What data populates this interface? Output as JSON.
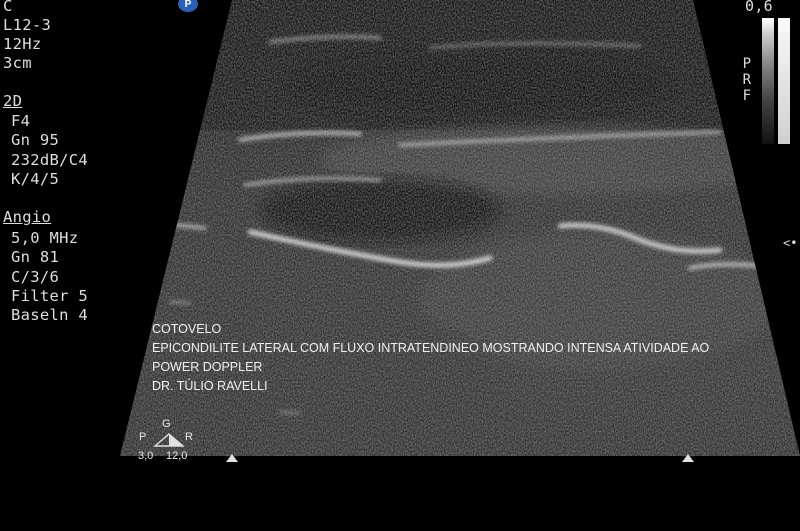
{
  "header": {
    "probe_letter": "C",
    "probe": "L12-3",
    "frame_rate": "12Hz",
    "depth": "3cm",
    "badge": "P"
  },
  "mode_2d": {
    "title": "2D",
    "lines": [
      "F4",
      "Gn 95",
      "232dB/C4",
      "K/4/5"
    ]
  },
  "mode_angio": {
    "title": "Angio",
    "lines": [
      "5,0 MHz",
      "Gn 81",
      "C/3/6",
      "Filter 5",
      "Baseln 4"
    ]
  },
  "annotation": {
    "line1": "COTOVELO",
    "line2": "EPICONDILITE LATERAL COM FLUXO INTRATENDINEO MOSTRANDO INTENSA ATIVIDADE AO",
    "line3": "POWER DOPPLER",
    "line4": "DR. TÚLIO RAVELLI"
  },
  "color_scale": {
    "max": "0,6",
    "label": "PRF"
  },
  "orientation": {
    "p": "P",
    "g": "G",
    "r": "R",
    "left_value": "3,0",
    "right_value": "12,0"
  },
  "icons": [
    "focus-marker-icon",
    "scan-edge-marker-icon",
    "orientation-triangle-icon"
  ]
}
